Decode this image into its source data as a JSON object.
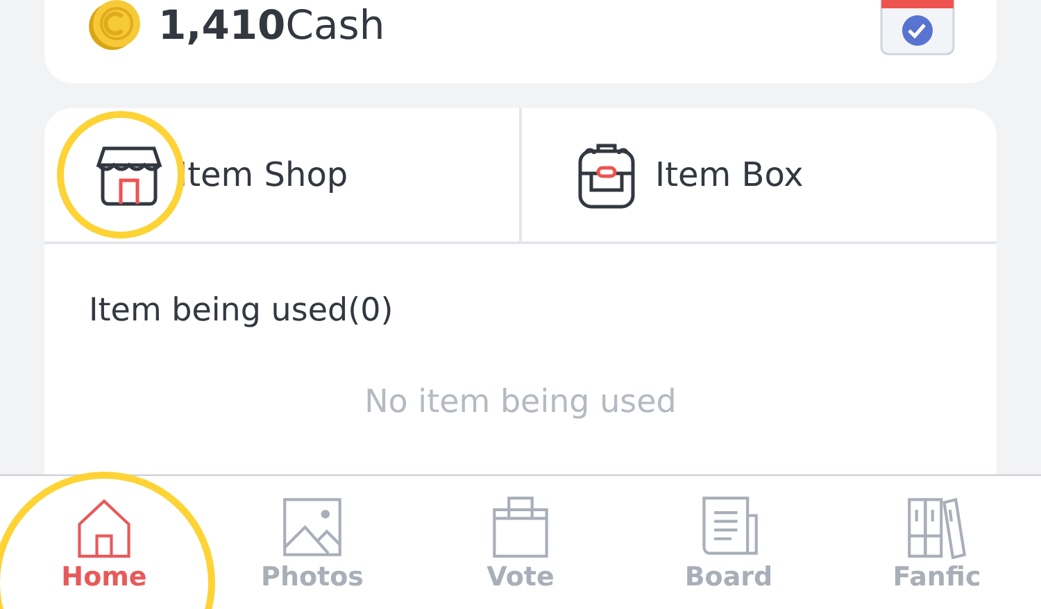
{
  "wallet": {
    "amount": "1,410",
    "unit": "Cash"
  },
  "item_menu": [
    {
      "label": "Item Shop",
      "highlighted": true
    },
    {
      "label": "Item Box",
      "highlighted": false
    }
  ],
  "items_in_use": {
    "heading": "Item being used(0)",
    "empty_text": "No item being used"
  },
  "tab_bar": [
    {
      "label": "Home",
      "selected": true,
      "highlighted": true
    },
    {
      "label": "Photos",
      "selected": false,
      "highlighted": false
    },
    {
      "label": "Vote",
      "selected": false,
      "highlighted": false
    },
    {
      "label": "Board",
      "selected": false,
      "highlighted": false
    },
    {
      "label": "Fanfic",
      "selected": false,
      "highlighted": false
    }
  ]
}
